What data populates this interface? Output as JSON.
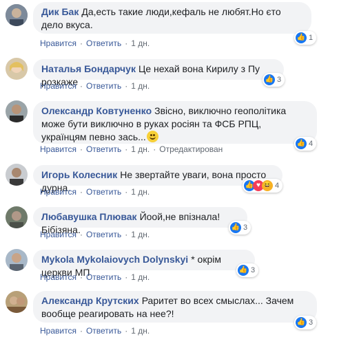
{
  "labels": {
    "like": "Нравится",
    "reply": "Ответить",
    "dot": "·"
  },
  "colors": {
    "author": "#385898",
    "bubble": "#f2f3f5",
    "meta": "#606770",
    "like": "#1877f2",
    "love": "#f33e58",
    "haha": "#f7b125"
  },
  "comments": [
    {
      "author": "Дик Бак",
      "text": "Да,есть такие люди,кефаль не любят.Но єто дело вкуса.",
      "time": "1 дн.",
      "reactions": [
        "like-icon"
      ],
      "count": "1"
    },
    {
      "author": "Наталья Бондарчук",
      "text": "Це нехай вона Кирилу з Пу розкаже",
      "time": "1 дн.",
      "reactions": [
        "like-icon"
      ],
      "count": "3"
    },
    {
      "author": "Олександр Ковтуненко",
      "text": "Звісно, виключно геополітика може бути виключно в руках росіян та ФСБ РПЦ, українцям певно зась...",
      "time": "1 дн.",
      "edited": "Отредактирован",
      "reactions": [
        "like-icon"
      ],
      "count": "4",
      "emoji": "smile-emoji"
    },
    {
      "author": "Игорь Колесник",
      "text": "Не звертайте уваги, вона просто дурна.",
      "time": "1 дн.",
      "reactions": [
        "like-icon",
        "love-icon",
        "haha-icon"
      ],
      "count": "4"
    },
    {
      "author": "Любавушка Плювак",
      "text": "Йоой,не впізнала! Бібізяна.",
      "time": "1 дн.",
      "reactions": [
        "like-icon"
      ],
      "count": "3"
    },
    {
      "author": "Mykola Mykolaiovych Dolynskyi",
      "text": "* окрім церкви МП",
      "time": "1 дн.",
      "reactions": [
        "like-icon"
      ],
      "count": "3"
    },
    {
      "author": "Александр Крутских",
      "text": "Раритет во всех смыслах... Зачем вообще реагировать на нее?!",
      "time": "1 дн.",
      "reactions": [
        "like-icon"
      ],
      "count": "3"
    }
  ]
}
